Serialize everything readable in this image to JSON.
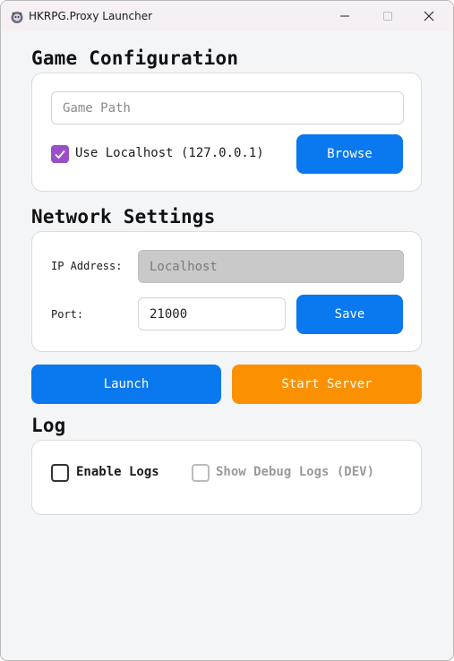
{
  "window": {
    "title": "HKRPG.Proxy Launcher"
  },
  "game_config": {
    "heading": "Game Configuration",
    "game_path_placeholder": "Game Path",
    "game_path_value": "",
    "use_localhost_label": "Use Localhost (127.0.0.1)",
    "use_localhost_checked": true,
    "browse_label": "Browse"
  },
  "network": {
    "heading": "Network Settings",
    "ip_label": "IP Address:",
    "ip_placeholder": "Localhost",
    "port_label": "Port:",
    "port_value": "21000",
    "save_label": "Save"
  },
  "actions": {
    "launch_label": "Launch",
    "start_server_label": "Start Server"
  },
  "log": {
    "heading": "Log",
    "enable_logs_label": "Enable Logs",
    "enable_logs_checked": false,
    "debug_logs_label": "Show Debug Logs (DEV)",
    "debug_logs_checked": false
  },
  "colors": {
    "accent_blue": "#0a78ee",
    "accent_orange": "#fb9101",
    "checkbox_purple": "#9a4fc9"
  }
}
